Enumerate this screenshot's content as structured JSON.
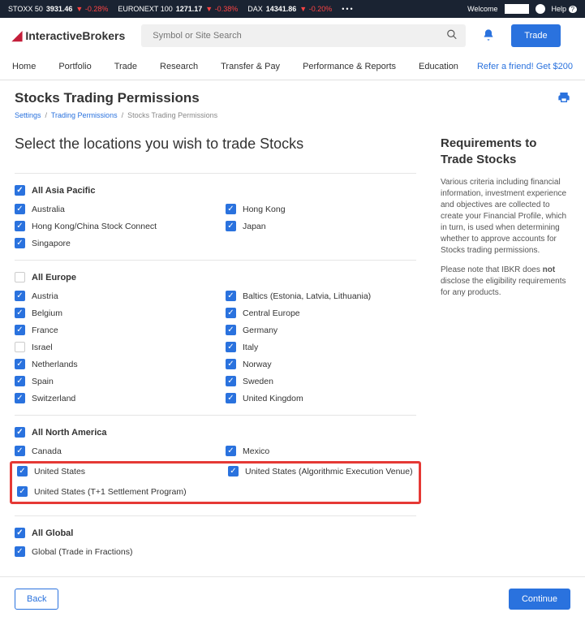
{
  "topbar": {
    "tickers": [
      {
        "name": "STOXX 50",
        "value": "3931.46",
        "change": "-0.28%"
      },
      {
        "name": "EURONEXT 100",
        "value": "1271.17",
        "change": "-0.38%"
      },
      {
        "name": "DAX",
        "value": "14341.86",
        "change": "-0.20%"
      }
    ],
    "welcome": "Welcome",
    "help": "Help"
  },
  "header": {
    "logo": "InteractiveBrokers",
    "search_placeholder": "Symbol or Site Search",
    "trade_btn": "Trade"
  },
  "nav": {
    "items": [
      "Home",
      "Portfolio",
      "Trade",
      "Research",
      "Transfer & Pay",
      "Performance & Reports",
      "Education"
    ],
    "refer": "Refer a friend! Get $200"
  },
  "page": {
    "title": "Stocks Trading Permissions",
    "breadcrumb": [
      {
        "label": "Settings",
        "link": true
      },
      {
        "label": "Trading Permissions",
        "link": true
      },
      {
        "label": "Stocks Trading Permissions",
        "link": false
      }
    ],
    "section_title": "Select the locations you wish to trade Stocks"
  },
  "regions": {
    "asia": {
      "title": "All Asia Pacific",
      "checked": true,
      "items": [
        {
          "label": "Australia",
          "checked": true
        },
        {
          "label": "Hong Kong",
          "checked": true
        },
        {
          "label": "Hong Kong/China Stock Connect",
          "checked": true
        },
        {
          "label": "Japan",
          "checked": true
        },
        {
          "label": "Singapore",
          "checked": true
        }
      ]
    },
    "europe": {
      "title": "All Europe",
      "checked": false,
      "items": [
        {
          "label": "Austria",
          "checked": true
        },
        {
          "label": "Baltics (Estonia, Latvia, Lithuania)",
          "checked": true
        },
        {
          "label": "Belgium",
          "checked": true
        },
        {
          "label": "Central Europe",
          "checked": true
        },
        {
          "label": "France",
          "checked": true
        },
        {
          "label": "Germany",
          "checked": true
        },
        {
          "label": "Israel",
          "checked": false
        },
        {
          "label": "Italy",
          "checked": true
        },
        {
          "label": "Netherlands",
          "checked": true
        },
        {
          "label": "Norway",
          "checked": true
        },
        {
          "label": "Spain",
          "checked": true
        },
        {
          "label": "Sweden",
          "checked": true
        },
        {
          "label": "Switzerland",
          "checked": true
        },
        {
          "label": "United Kingdom",
          "checked": true
        }
      ]
    },
    "na": {
      "title": "All North America",
      "checked": true,
      "items_top": [
        {
          "label": "Canada",
          "checked": true
        },
        {
          "label": "Mexico",
          "checked": true
        }
      ],
      "items_hl": [
        {
          "label": "United States",
          "checked": true
        },
        {
          "label": "United States (Algorithmic Execution Venue)",
          "checked": true
        },
        {
          "label": "United States (T+1 Settlement Program)",
          "checked": true
        }
      ]
    },
    "global": {
      "title": "All Global",
      "checked": true,
      "items": [
        {
          "label": "Global (Trade in Fractions)",
          "checked": true
        }
      ]
    }
  },
  "sidebar": {
    "title": "Requirements to Trade Stocks",
    "p1": "Various criteria including financial information, investment experience and objectives are collected to create your Financial Profile, which in turn, is used when determining whether to approve accounts for Stocks trading permissions.",
    "p2a": "Please note that IBKR does ",
    "p2b": "not",
    "p2c": " disclose the eligibility requirements for any products."
  },
  "footer": {
    "back": "Back",
    "continue": "Continue"
  }
}
